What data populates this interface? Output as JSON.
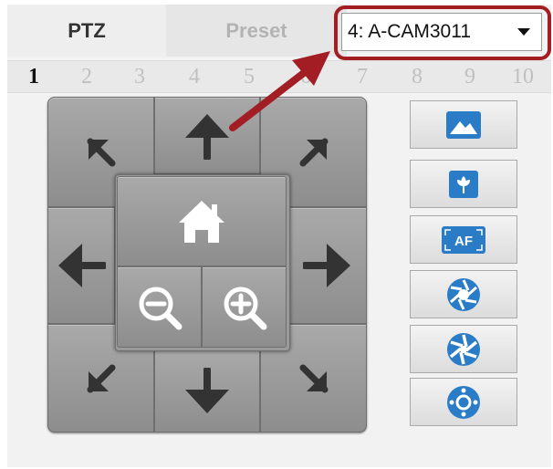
{
  "tabs": {
    "ptz": "PTZ",
    "preset": "Preset"
  },
  "camera_select": {
    "value": "4: A-CAM3011"
  },
  "numbers": [
    "1",
    "2",
    "3",
    "4",
    "5",
    "6",
    "7",
    "8",
    "9",
    "10"
  ],
  "active_number": "1",
  "tools": {
    "af_label": "AF"
  },
  "colors": {
    "highlight": "#a21d24",
    "tool_icon": "#2a7cc7",
    "pad": "#8f8f8f"
  },
  "icons": {
    "pad": [
      "arrow-up-left-icon",
      "arrow-up-icon",
      "arrow-up-right-icon",
      "arrow-left-icon",
      "arrow-right-icon",
      "arrow-down-left-icon",
      "arrow-down-icon",
      "arrow-down-right-icon",
      "home-icon",
      "zoom-out-icon",
      "zoom-in-icon"
    ],
    "tools": [
      "landscape-icon",
      "macro-flower-icon",
      "autofocus-icon",
      "iris-open-icon",
      "iris-close-icon",
      "iris-auto-icon"
    ]
  }
}
